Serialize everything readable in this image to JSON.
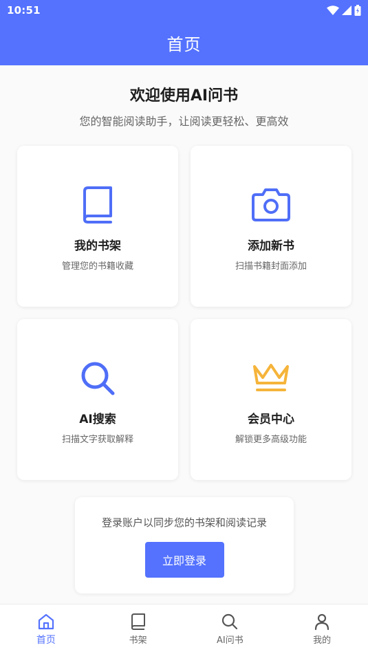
{
  "status_bar": {
    "time": "10:51"
  },
  "app_bar": {
    "title": "首页"
  },
  "welcome": {
    "title": "欢迎使用AI问书",
    "subtitle": "您的智能阅读助手，让阅读更轻松、更高效"
  },
  "cards": [
    {
      "title": "我的书架",
      "desc": "管理您的书籍收藏",
      "icon": "book-icon",
      "color": "#4f6ef7"
    },
    {
      "title": "添加新书",
      "desc": "扫描书籍封面添加",
      "icon": "camera-icon",
      "color": "#4f6ef7"
    },
    {
      "title": "AI搜索",
      "desc": "扫描文字获取解释",
      "icon": "search-icon",
      "color": "#4f6ef7"
    },
    {
      "title": "会员中心",
      "desc": "解锁更多高级功能",
      "icon": "crown-icon",
      "color": "#f5b43a"
    }
  ],
  "login": {
    "prompt": "登录账户以同步您的书架和阅读记录",
    "button": "立即登录"
  },
  "bottom_nav": [
    {
      "label": "首页",
      "icon": "home-icon",
      "active": true
    },
    {
      "label": "书架",
      "icon": "book-icon",
      "active": false
    },
    {
      "label": "AI问书",
      "icon": "search-icon",
      "active": false
    },
    {
      "label": "我的",
      "icon": "person-icon",
      "active": false
    }
  ],
  "colors": {
    "primary": "#5472fe",
    "crown": "#f5b43a",
    "inactive": "#555555"
  }
}
